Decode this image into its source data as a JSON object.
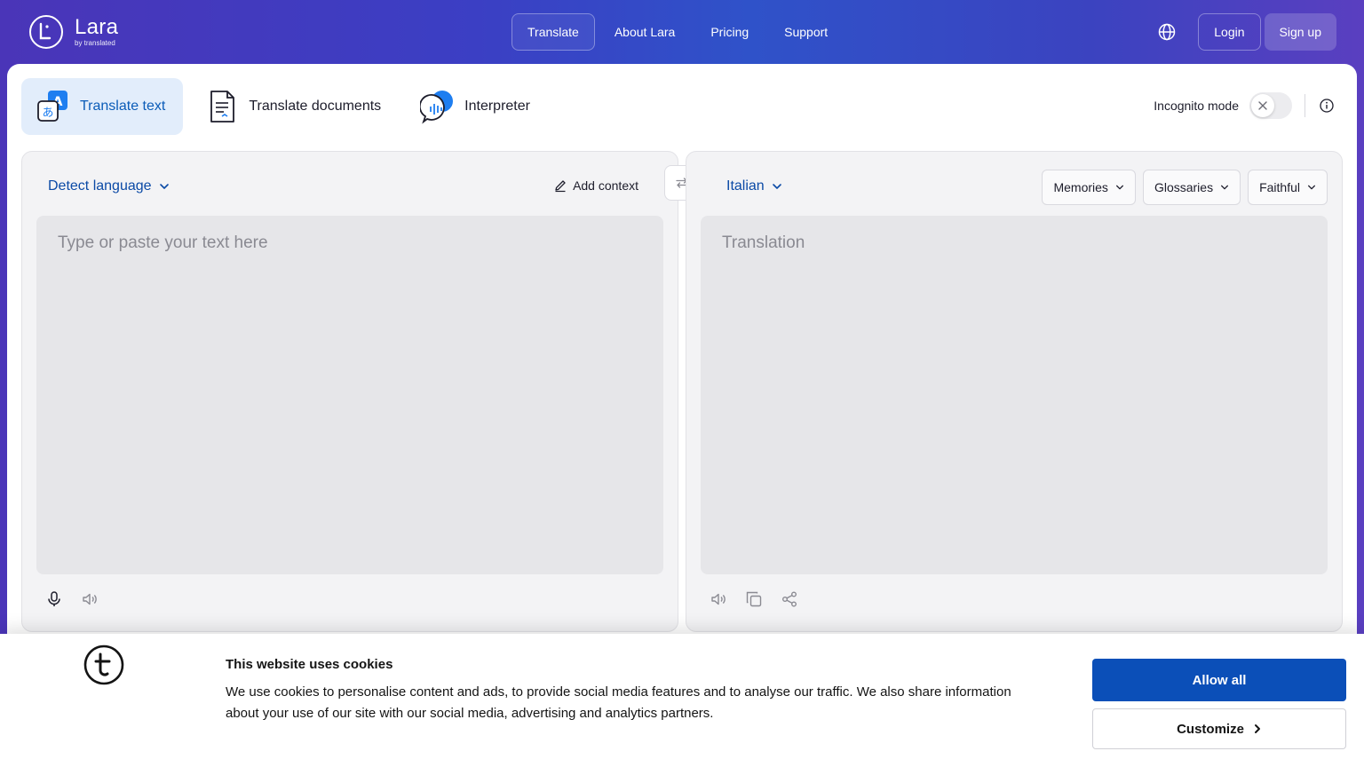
{
  "brand": {
    "name": "Lara",
    "subtitle": "by translated"
  },
  "nav": {
    "items": [
      {
        "label": "Translate",
        "active": true
      },
      {
        "label": "About Lara",
        "active": false
      },
      {
        "label": "Pricing",
        "active": false
      },
      {
        "label": "Support",
        "active": false
      }
    ],
    "language_icon": "globe-icon",
    "login_label": "Login",
    "signup_label": "Sign up"
  },
  "modes": [
    {
      "label": "Translate text",
      "icon": "translate-text-icon",
      "active": true
    },
    {
      "label": "Translate documents",
      "icon": "document-icon",
      "active": false
    },
    {
      "label": "Interpreter",
      "icon": "interpreter-icon",
      "active": false
    }
  ],
  "incognito": {
    "label": "Incognito mode",
    "enabled": false
  },
  "source": {
    "language": "Detect language",
    "add_context_label": "Add context",
    "placeholder": "Type or paste your text here"
  },
  "target": {
    "language": "Italian",
    "placeholder": "Translation",
    "tools": [
      {
        "label": "Memories"
      },
      {
        "label": "Glossaries"
      },
      {
        "label": "Faithful"
      }
    ]
  },
  "cookie": {
    "title": "This website uses cookies",
    "text": "We use cookies to personalise content and ads, to provide social media features and to analyse our traffic. We also share information about your use of our site with our social media, advertising and analytics partners.",
    "allow_label": "Allow all",
    "customize_label": "Customize"
  },
  "colors": {
    "accent": "#0b5cb8",
    "cta": "#0b4fb8",
    "header_gradient_start": "#4a35b8",
    "header_gradient_end": "#5a3fc0",
    "active_tab_bg": "#e2edfb"
  }
}
